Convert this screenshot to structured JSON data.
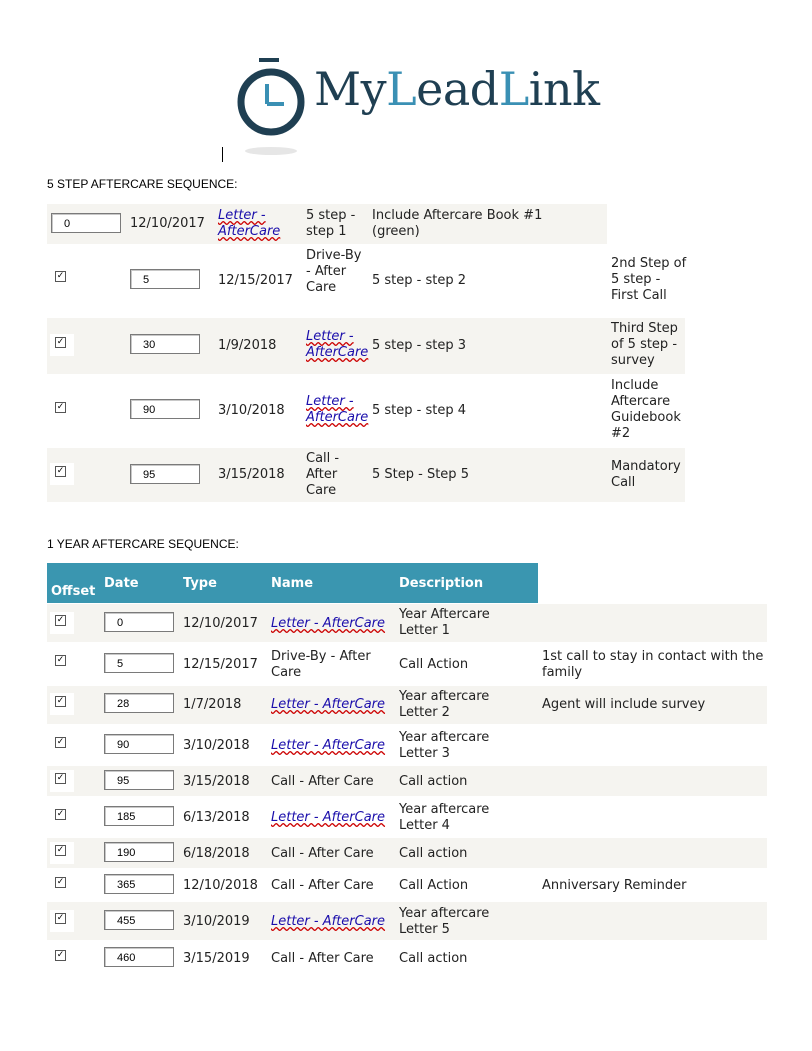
{
  "logo": {
    "part1": "My",
    "part2": "L",
    "part3": "ead",
    "part4": "L",
    "part5": "ink"
  },
  "colors": {
    "logo_dark": "#1f3f52",
    "logo_accent": "#3a90b4",
    "header_bg": "#3a96b0",
    "band": "#f5f4f0",
    "link": "#1a0dab"
  },
  "five_step": {
    "heading": "5 STEP AFTERCARE SEQUENCE:",
    "rows": [
      {
        "offset": "0",
        "date": "12/10/2017",
        "type": "Letter - AfterCare",
        "type_link": true,
        "name": "5 step - step 1",
        "description": "Include Aftercare Book #1 (green)",
        "note": "",
        "checked": false
      },
      {
        "offset": "5",
        "date": "12/15/2017",
        "type": "Drive-By - After Care",
        "type_link": false,
        "name": "5 step - step 2",
        "description": "",
        "note": "2nd Step of 5 step - First Call",
        "checked": true
      },
      {
        "offset": "30",
        "date": "1/9/2018",
        "type": "Letter - AfterCare",
        "type_link": true,
        "name": "5 step - step 3",
        "description": "",
        "note": "Third Step of 5 step - survey",
        "checked": true
      },
      {
        "offset": "90",
        "date": "3/10/2018",
        "type": "Letter - AfterCare",
        "type_link": true,
        "name": "5 step - step 4",
        "description": "",
        "note": "Include Aftercare Guidebook #2",
        "checked": true
      },
      {
        "offset": "95",
        "date": "3/15/2018",
        "type": "Call - After Care",
        "type_link": false,
        "name": "5 Step - Step 5",
        "description": "",
        "note": "Mandatory Call",
        "checked": true
      }
    ]
  },
  "one_year": {
    "heading": "1 YEAR AFTERCARE SEQUENCE:",
    "columns": {
      "offset": "Offset",
      "date": "Date",
      "type": "Type",
      "name": "Name",
      "description": "Description"
    },
    "rows": [
      {
        "offset": "0",
        "date": "12/10/2017",
        "type": "Letter - AfterCare",
        "type_link": true,
        "name": "Year Aftercare Letter 1",
        "description": "",
        "checked": true
      },
      {
        "offset": "5",
        "date": "12/15/2017",
        "type": "Drive-By - After Care",
        "type_link": false,
        "name": "Call Action",
        "description": "1st call to stay in contact with the family",
        "checked": true
      },
      {
        "offset": "28",
        "date": "1/7/2018",
        "type": "Letter - AfterCare",
        "type_link": true,
        "name": "Year aftercare Letter 2",
        "description": "Agent will include survey",
        "checked": true
      },
      {
        "offset": "90",
        "date": "3/10/2018",
        "type": "Letter - AfterCare",
        "type_link": true,
        "name": "Year aftercare Letter 3",
        "description": "",
        "checked": true
      },
      {
        "offset": "95",
        "date": "3/15/2018",
        "type": "Call - After Care",
        "type_link": false,
        "name": "Call action",
        "description": "",
        "checked": true
      },
      {
        "offset": "185",
        "date": "6/13/2018",
        "type": "Letter - AfterCare",
        "type_link": true,
        "name": "Year aftercare Letter 4",
        "description": "",
        "checked": true
      },
      {
        "offset": "190",
        "date": "6/18/2018",
        "type": "Call - After Care",
        "type_link": false,
        "name": "Call action",
        "description": "",
        "checked": true
      },
      {
        "offset": "365",
        "date": "12/10/2018",
        "type": "Call - After Care",
        "type_link": false,
        "name": "Call Action",
        "description": "Anniversary Reminder",
        "checked": true
      },
      {
        "offset": "455",
        "date": "3/10/2019",
        "type": "Letter - AfterCare",
        "type_link": true,
        "name": "Year aftercare Letter 5",
        "description": "",
        "checked": true
      },
      {
        "offset": "460",
        "date": "3/15/2019",
        "type": "Call - After Care",
        "type_link": false,
        "name": "Call action",
        "description": "",
        "checked": true
      }
    ]
  }
}
